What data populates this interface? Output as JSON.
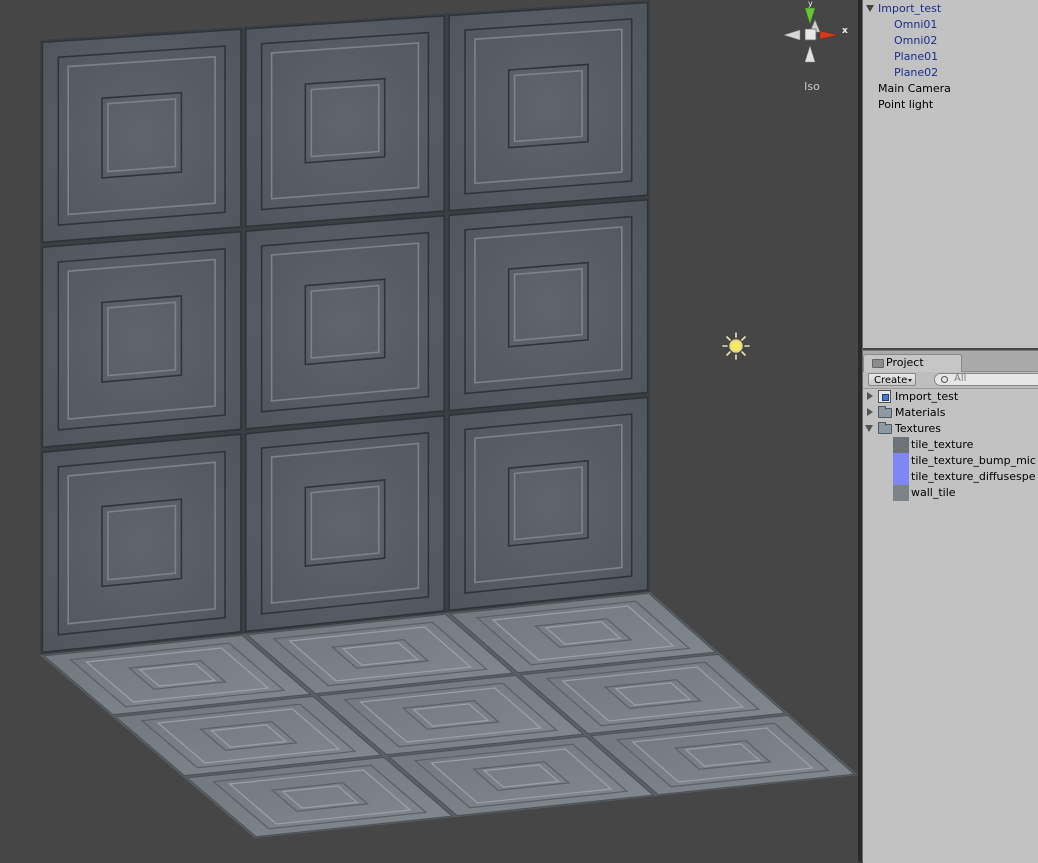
{
  "scene": {
    "gizmo_label": "Iso",
    "gizmo_axis_x": "x",
    "gizmo_axis_y": "y",
    "light_icon": "point-light-icon"
  },
  "hierarchy": {
    "items": [
      {
        "label": "Import_test",
        "expanded": true
      },
      {
        "label": "Omni01"
      },
      {
        "label": "Omni02"
      },
      {
        "label": "Plane01"
      },
      {
        "label": "Plane02"
      },
      {
        "label": "Main Camera"
      },
      {
        "label": "Point light"
      }
    ]
  },
  "project": {
    "tab_label": "Project",
    "create_label": "Create",
    "search_placeholder": "All",
    "items": [
      {
        "label": "Import_test",
        "icon": "prefab-icon",
        "expanded": false
      },
      {
        "label": "Materials",
        "icon": "folder-icon",
        "expanded": false
      },
      {
        "label": "Textures",
        "icon": "folder-icon",
        "expanded": true
      },
      {
        "label": "tile_texture",
        "icon": "texture-icon"
      },
      {
        "label": "tile_texture_bump_mic",
        "icon": "normalmap-icon"
      },
      {
        "label": "tile_texture_diffusespe",
        "icon": "normalmap-icon"
      },
      {
        "label": "wall_tile",
        "icon": "texture-icon"
      }
    ]
  },
  "colors": {
    "scene_bg": "#464646",
    "panel_bg": "#c2c2c2",
    "tile_face": "#5a6169",
    "floor_face": "#7a8085",
    "selected_text": "#1c2e8c",
    "gizmo_x": "#d43a1e",
    "gizmo_y": "#6ac23a"
  }
}
